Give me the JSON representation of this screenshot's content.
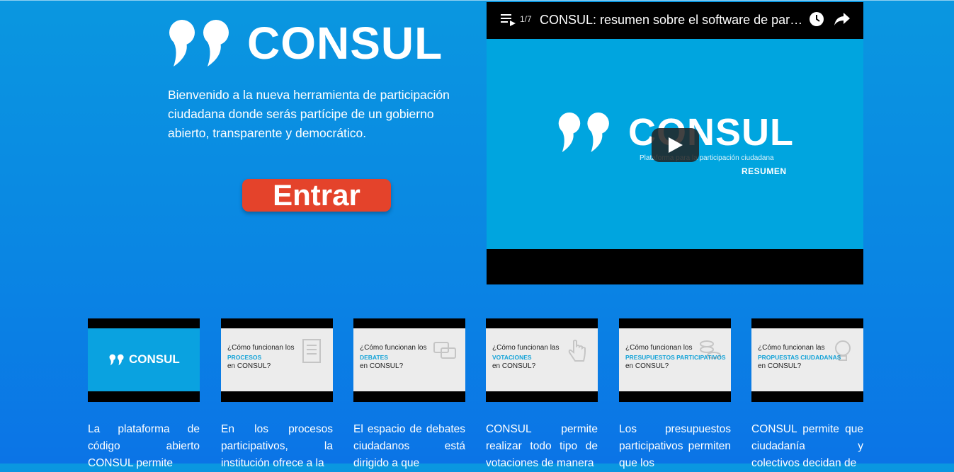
{
  "hero": {
    "brand": "CONSUL",
    "intro": "Bienvenido a la nueva herramienta de participación ciudadana donde serás partícipe de un gobierno abierto, transparente y democrático.",
    "enter_label": "Entrar"
  },
  "video": {
    "playlist_count": "1/7",
    "title": "CONSUL: resumen sobre el software de participación",
    "frame_brand": "CONSUL",
    "frame_subtitle": "Plataforma para la participación ciudadana",
    "frame_label": "RESUMEN"
  },
  "cards": [
    {
      "type": "logo",
      "thumb_brand": "CONSUL",
      "desc": "La plataforma de código abierto CONSUL permite"
    },
    {
      "type": "question",
      "line1": "¿Cómo funcionan los",
      "line2": "PROCESOS",
      "line3": "en CONSUL?",
      "desc": "En los procesos participativos, la institución ofrece a la"
    },
    {
      "type": "question",
      "line1": "¿Cómo funcionan los",
      "line2": "DEBATES",
      "line3": "en CONSUL?",
      "desc": "El espacio de debates ciudadanos está dirigido a que"
    },
    {
      "type": "question",
      "line1": "¿Cómo funcionan las",
      "line2": "VOTACIONES",
      "line3": "en CONSUL?",
      "desc": "CONSUL permite realizar todo tipo de votaciones de manera"
    },
    {
      "type": "question",
      "line1": "¿Cómo funcionan los",
      "line2": "PRESUPUESTOS PARTICIPATIVOS",
      "line3": "en CONSUL?",
      "desc": "Los presupuestos participativos permiten que los"
    },
    {
      "type": "question",
      "line1": "¿Cómo funcionan las",
      "line2": "PROPUESTAS CIUDADANAS",
      "line3": "en CONSUL?",
      "desc": "CONSUL permite que ciudadanía y colectivos decidan de"
    }
  ],
  "colors": {
    "background_top": "#0a97e0",
    "background_bottom": "#0b74e6",
    "enter_button": "#e4432b",
    "video_frame": "#00a5df",
    "thumb_accent": "#14a3d8"
  }
}
